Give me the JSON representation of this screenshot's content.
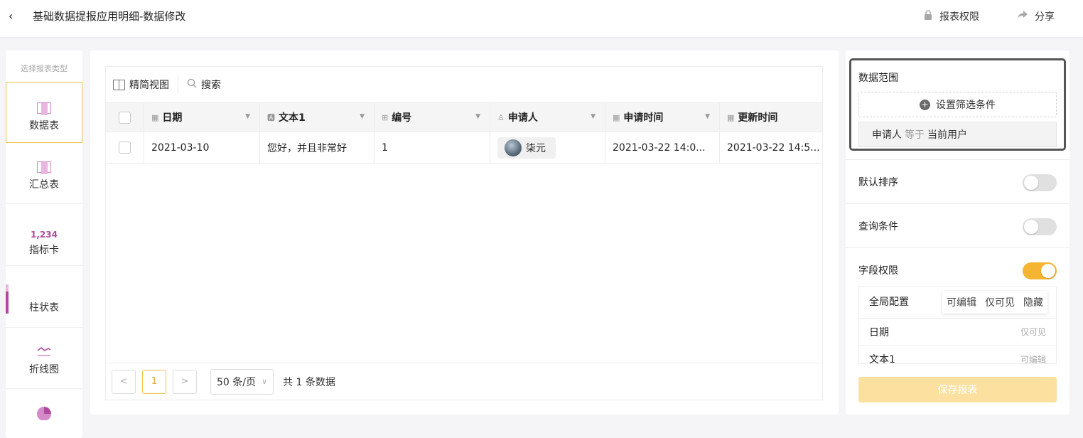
{
  "header": {
    "back_icon": "chevron-left-icon",
    "title": "基础数据提报应用明细-数据修改",
    "permission_label": "报表权限",
    "share_label": "分享"
  },
  "left_nav": {
    "heading": "选择报表类型",
    "items": [
      {
        "label": "数据表",
        "icon": "table-icon",
        "active": true
      },
      {
        "label": "汇总表",
        "icon": "summary-table-icon",
        "active": false
      },
      {
        "label": "指标卡",
        "icon": "kpi-card-icon",
        "icon_text": "1,234",
        "active": false
      },
      {
        "label": "柱状表",
        "icon": "bar-chart-icon",
        "active": false
      },
      {
        "label": "折线图",
        "icon": "line-chart-icon",
        "active": false
      }
    ]
  },
  "grid": {
    "view_label": "精简视图",
    "search_label": "搜索",
    "columns": [
      {
        "label": "日期",
        "icon": "calendar-icon"
      },
      {
        "label": "文本1",
        "icon": "text-icon"
      },
      {
        "label": "编号",
        "icon": "number-icon"
      },
      {
        "label": "申请人",
        "icon": "user-icon"
      },
      {
        "label": "申请时间",
        "icon": "calendar-icon"
      },
      {
        "label": "更新时间",
        "icon": "calendar-icon"
      }
    ],
    "rows": [
      {
        "date": "2021-03-10",
        "text1": "您好，并且非常好",
        "number": "1",
        "applicant": "柒元",
        "apply_time": "2021-03-22 14:0...",
        "update_time": "2021-03-22 14:5..."
      }
    ],
    "pager": {
      "prev": "<",
      "current_page": "1",
      "next": ">",
      "page_size": "50 条/页",
      "total": "共 1 条数据"
    }
  },
  "right_panel": {
    "data_scope": {
      "title": "数据范围",
      "add_condition": "设置筛选条件",
      "condition": {
        "field": "申请人",
        "operator": "等于",
        "value": "当前用户"
      }
    },
    "default_sort": {
      "label": "默认排序",
      "enabled": false
    },
    "query_conditions": {
      "label": "查询条件",
      "enabled": false
    },
    "field_permissions": {
      "label": "字段权限",
      "enabled": true,
      "global_label": "全局配置",
      "options": [
        "可编辑",
        "仅可见",
        "隐藏"
      ],
      "fields": [
        {
          "name": "日期",
          "permission": "仅可见"
        },
        {
          "name": "文本1",
          "permission": "可编辑"
        }
      ]
    },
    "save_button": "保存报表"
  },
  "colors": {
    "accent": "#f5b532",
    "accent_light": "#fbe0a0",
    "chart_purple": "#b14a9e"
  }
}
